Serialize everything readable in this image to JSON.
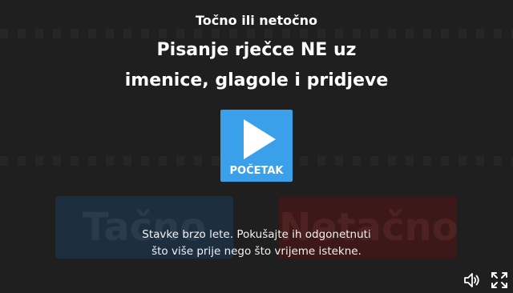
{
  "activity": {
    "subtitle": "Točno ili netočno",
    "title_line1": "Pisanje rječce NE uz",
    "title_line2": "imenice, glagole i pridjeve"
  },
  "start_button": {
    "label": "POČETAK",
    "icon": "play-icon"
  },
  "answers": {
    "true_label": "Tačno",
    "false_label": "Netačno"
  },
  "instructions": {
    "line1": "Stavke brzo lete. Pokušajte ih odgonetnuti",
    "line2": "što više prije nego što vrijeme istekne."
  },
  "controls": {
    "sound_icon": "speaker-icon",
    "fullscreen_icon": "fullscreen-icon"
  },
  "colors": {
    "accent": "#3aa0ea",
    "background": "#1f1f1f"
  }
}
